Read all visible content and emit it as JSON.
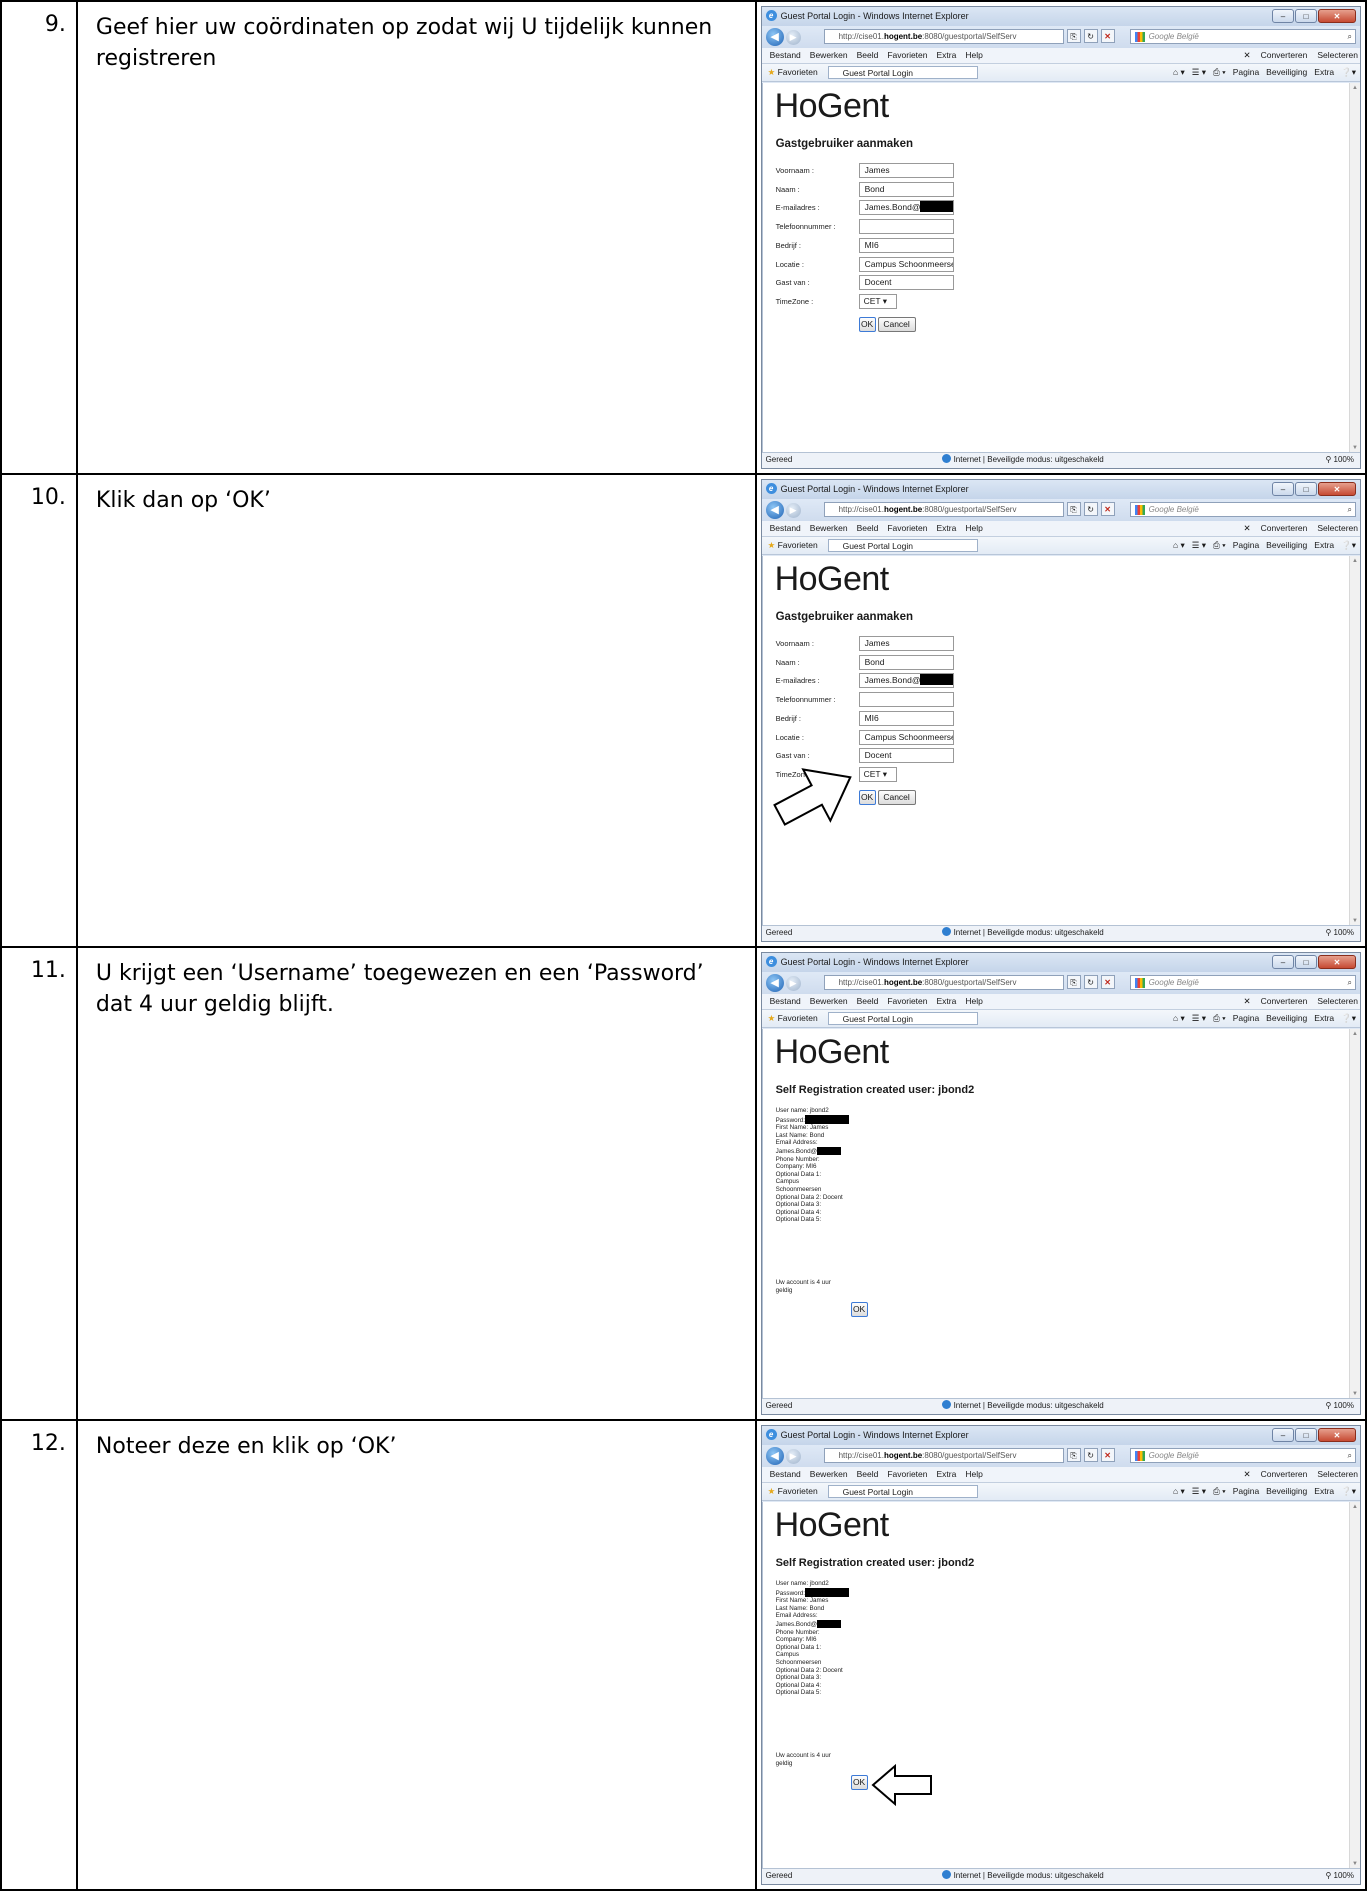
{
  "steps": [
    {
      "num": "9.",
      "text": "Geef hier uw coördinaten op zodat wij U tijdelijk kunnen registreren",
      "screen": "form",
      "arrow": "none"
    },
    {
      "num": "10.",
      "text": "Klik dan op ‘OK’",
      "screen": "form",
      "arrow": "ok-form"
    },
    {
      "num": "11.",
      "text": "U krijgt een ‘Username’ toegewezen en een ‘Password’ dat 4 uur geldig blijft.",
      "screen": "result",
      "arrow": "none"
    },
    {
      "num": "12.",
      "text": "Noteer deze en klik op ‘OK’",
      "screen": "result",
      "arrow": "ok-result"
    }
  ],
  "browser": {
    "window_title": "Guest Portal Login - Windows Internet Explorer",
    "address_prefix": "http://cise01.",
    "address_host": "hogent.be",
    "address_suffix": ":8080/guestportal/SelfServ",
    "search_placeholder": "Google België",
    "menu": [
      "Bestand",
      "Bewerken",
      "Beeld",
      "Favorieten",
      "Extra",
      "Help"
    ],
    "menu_right": [
      "Converteren",
      "Selecteren"
    ],
    "favorites_label": "Favorieten",
    "tab_label": "Guest Portal Login",
    "toolbar_right": [
      "Pagina",
      "Beveiliging",
      "Extra"
    ],
    "status_ready": "Gereed",
    "status_zone": "Internet | Beveiligde modus: uitgeschakeld",
    "zoom": "100%"
  },
  "portal": {
    "logo": "HoGent",
    "form_title": "Gastgebruiker aanmaken",
    "fields": [
      {
        "label": "Voornaam :",
        "value": "James"
      },
      {
        "label": "Naam :",
        "value": "Bond"
      },
      {
        "label": "E-mailadres :",
        "value": "James.Bond@",
        "redacted": true
      },
      {
        "label": "Telefoonnummer :",
        "value": ""
      },
      {
        "label": "Bedrijf :",
        "value": "MI6"
      },
      {
        "label": "Locatie :",
        "value": "Campus Schoonmeersen"
      },
      {
        "label": "Gast van :",
        "value": "Docent"
      }
    ],
    "timezone_label": "TimeZone :",
    "timezone_value": "CET",
    "ok_label": "OK",
    "cancel_label": "Cancel",
    "result_title": "Self Registration created user: jbond2",
    "result_lines": [
      "User name: jbond2",
      "Password:",
      "First Name: James",
      "Last Name: Bond",
      "Email Address:",
      "James.Bond@",
      "Phone Number:",
      "Company: MI6",
      "Optional Data 1:",
      "Campus",
      "Schoonmeersen",
      "Optional Data 2: Docent",
      "Optional Data 3:",
      "Optional Data 4:",
      "Optional Data 5:"
    ],
    "result_footer": [
      "Uw account is 4 uur",
      "geldig"
    ]
  }
}
